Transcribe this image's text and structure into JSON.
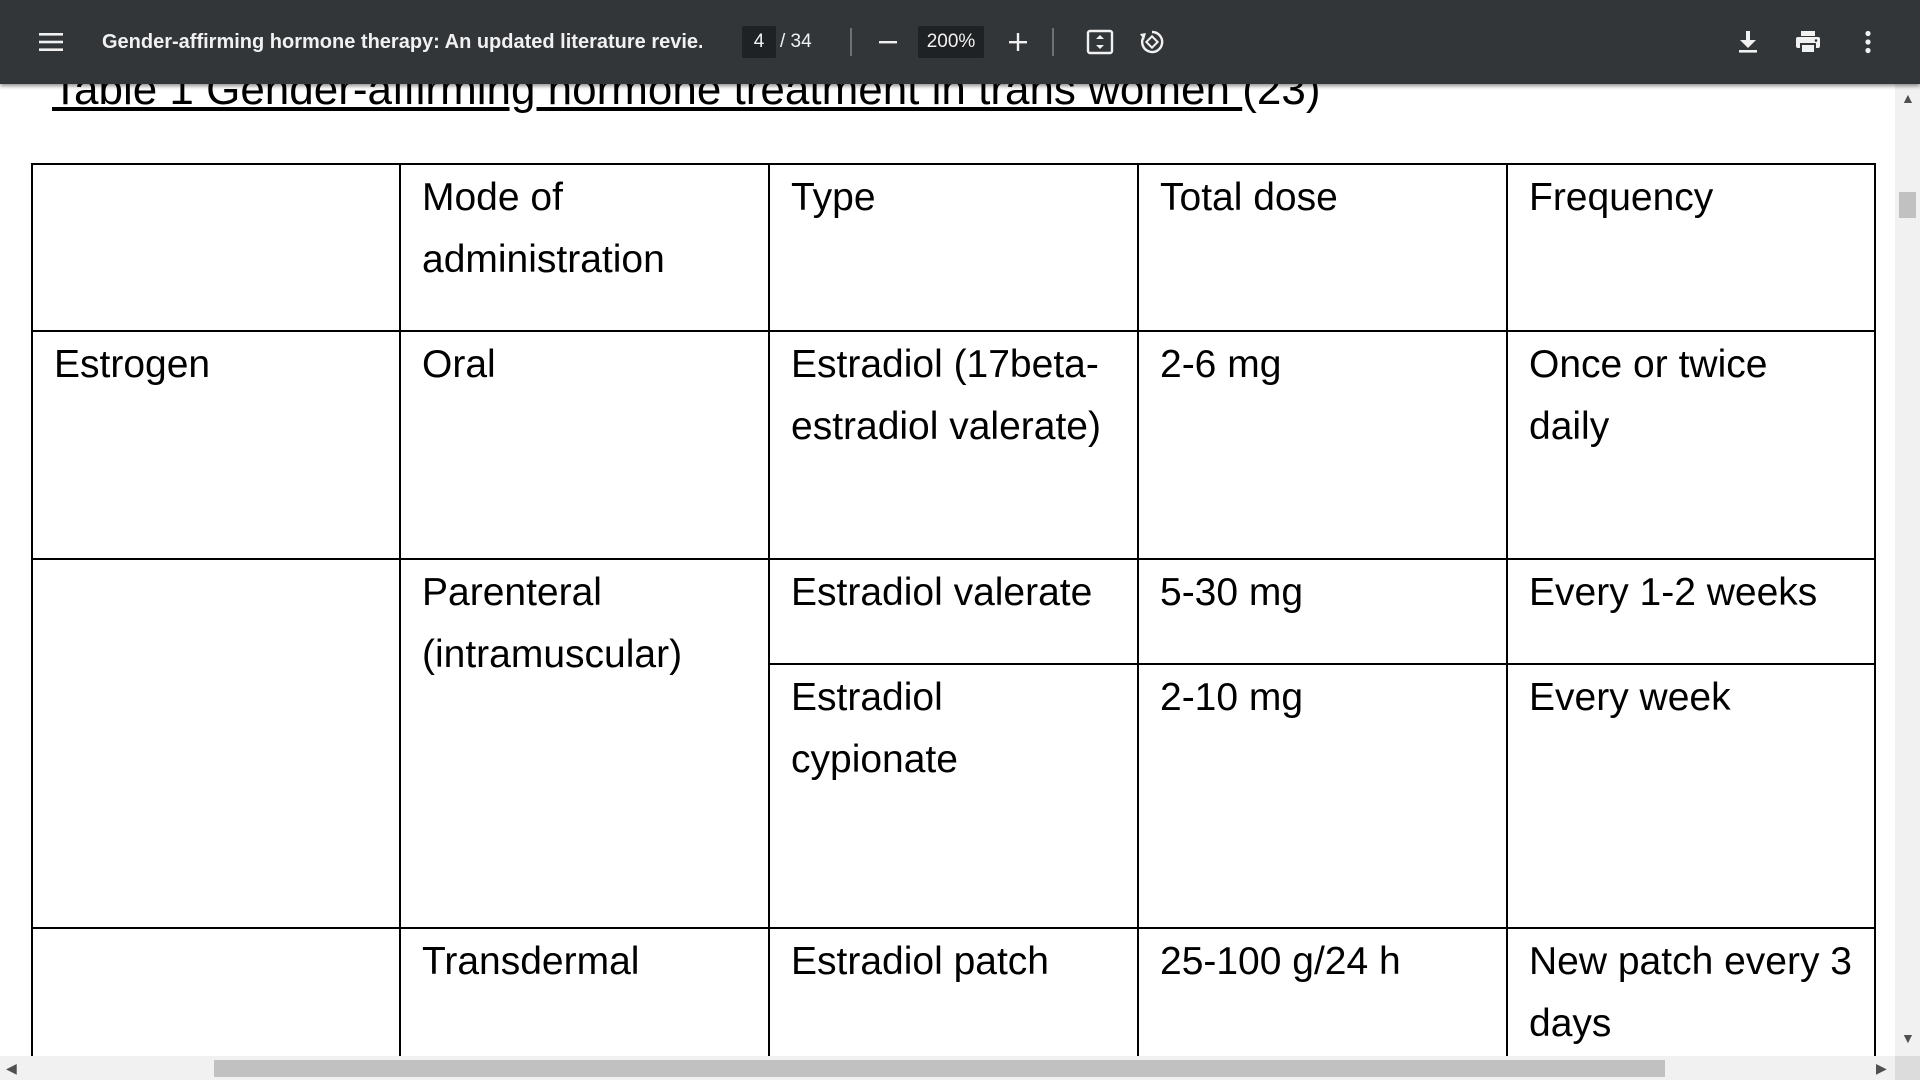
{
  "toolbar": {
    "title": "Gender-affirming hormone therapy: An updated literature revie...",
    "page_current": "4",
    "page_total_label": "/ 34",
    "zoom": "200%"
  },
  "icons": {
    "menu": "hamburger-menu-icon",
    "zoom_out": "minus-icon",
    "zoom_in": "plus-icon",
    "fit": "fit-to-page-icon",
    "rotate": "rotate-counterclockwise-icon",
    "download": "download-icon",
    "print": "print-icon",
    "more": "more-vertical-icon"
  },
  "document": {
    "caption_underlined": "Table 1 Gender-affirming hormone treatment in trans women ",
    "caption_rest": "(23)",
    "table": {
      "headers": [
        "",
        "Mode of administration",
        "Type",
        "Total dose",
        "Frequency"
      ],
      "rows": [
        {
          "hormone": "Estrogen",
          "mode": "Oral",
          "type": "Estradiol (17beta-estradiol valerate)",
          "dose": "2-6 mg",
          "frequency": "Once or twice daily"
        },
        {
          "hormone": "",
          "mode": "Parenteral (intramuscular)",
          "type": "Estradiol valerate",
          "dose": "5-30 mg",
          "frequency": "Every 1-2 weeks"
        },
        {
          "type": "Estradiol cypionate",
          "dose": "2-10 mg",
          "frequency": "Every week"
        },
        {
          "hormone": "",
          "mode": "Transdermal",
          "type": "Estradiol patch",
          "dose": "25-100 g/24 h",
          "frequency": "New patch every 3 days"
        }
      ]
    }
  },
  "colors": {
    "toolbar_bg": "#323639",
    "toolbar_text": "#f1f1f1",
    "input_bg": "#1f2224",
    "page_bg": "#ffffff"
  }
}
